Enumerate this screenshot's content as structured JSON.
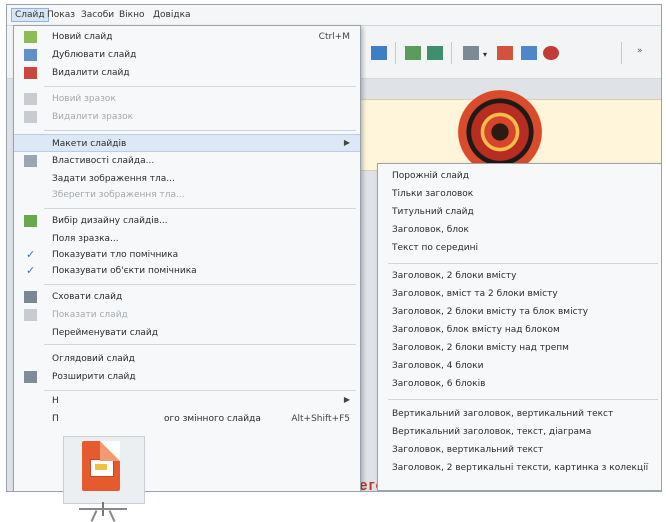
{
  "menubar": {
    "items": [
      "Слайд",
      "Показ",
      "Засоби",
      "Вікно",
      "Довідка"
    ]
  },
  "menu": {
    "new_slide": "Новий слайд",
    "new_slide_shortcut": "Ctrl+M",
    "duplicate_slide": "Дублювати слайд",
    "delete_slide": "Видалити слайд",
    "new_master": "Новий зразок",
    "delete_master": "Видалити зразок",
    "layouts": "Макети слайдів",
    "properties": "Властивості слайда...",
    "set_background": "Задати зображення тла...",
    "save_background": "Зберегти зображення тла...",
    "design": "Вибір дизайну слайдів...",
    "master_fields": "Поля зразка...",
    "show_master_background": "Показувати тло помічника",
    "show_master_objects": "Показувати об'єкти помічника",
    "hide_slide": "Сховати слайд",
    "show_slide": "Показати слайд",
    "rename_slide": "Перейменувати слайд",
    "summary_slide": "Оглядовий слайд",
    "expand_slide": "Розширити слайд",
    "truncated_item_1": "Н",
    "truncated_item_2_start": "П",
    "truncated_item_2_end": "ого змінного слайда",
    "truncated_item_2_shortcut": "Alt+Shift+F5"
  },
  "submenu": {
    "items": [
      "Порожній слайд",
      "Тільки заголовок",
      "Титульний слайд",
      "Заголовок, блок",
      "Текст по середині",
      "Заголовок, 2 блоки вмісту",
      "Заголовок, вміст та 2 блоки вмісту",
      "Заголовок, 2 блоки вмісту та блок вмісту",
      "Заголовок, блок вмісту над блоком",
      "Заголовок, 2 блоки вмісту над трепм",
      "Заголовок, 4 блоки",
      "Заголовок, 6 блоків",
      "Вертикальний заголовок, вертикальний текст",
      "Вертикальний заголовок, текст, діаграма",
      "Заголовок, вертикальний текст",
      "Заголовок, 2 вертикальні тексти, картинка з колекції"
    ]
  },
  "slide": {
    "bottom_text": "мегопцниий візерунок"
  },
  "colors": {
    "accent_check": "#3a78c3",
    "highlight": "#dce8f5",
    "logo_orange": "#e55b2d"
  }
}
